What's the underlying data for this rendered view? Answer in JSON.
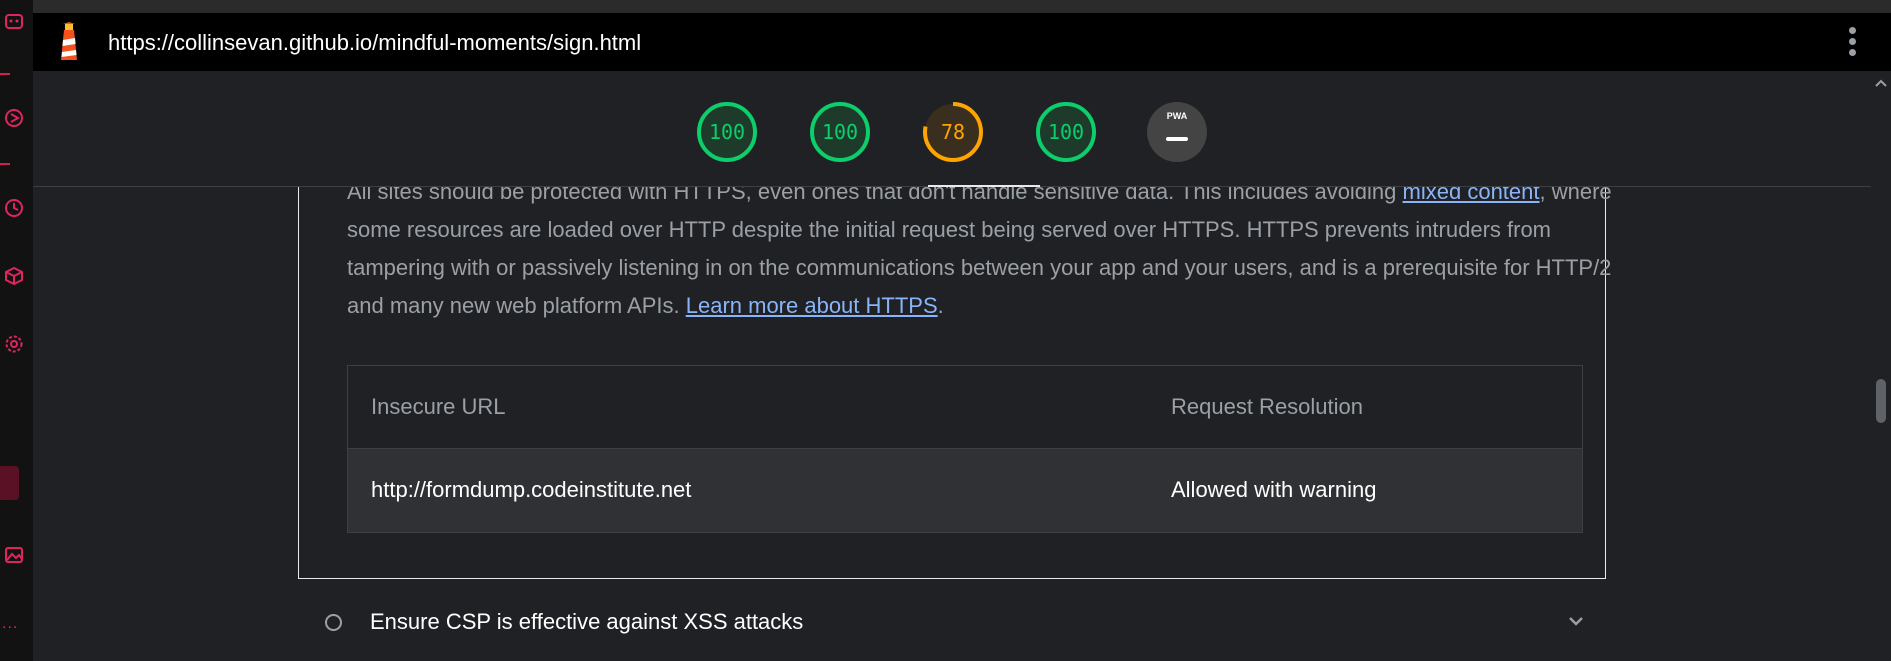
{
  "browser": {
    "url": "https://collinsevan.github.io/mindful-moments/sign.html"
  },
  "scores": [
    {
      "value": "100",
      "fraction": 1.0,
      "status": "pass",
      "color": "#0cce6b"
    },
    {
      "value": "100",
      "fraction": 1.0,
      "status": "pass",
      "color": "#0cce6b"
    },
    {
      "value": "78",
      "fraction": 0.78,
      "status": "average",
      "color": "#ffa400"
    },
    {
      "value": "100",
      "fraction": 1.0,
      "status": "pass",
      "color": "#0cce6b"
    },
    {
      "label": "PWA",
      "status": "na",
      "color": "#9aa0a6"
    }
  ],
  "audit_detail": {
    "text_1": "All sites should be protected with HTTPS, even ones that don't handle sensitive data. This includes avoiding ",
    "link_1": "mixed content",
    "text_2": ", where some resources are loaded over HTTP despite the initial request being served over HTTPS. HTTPS prevents intruders from tampering with or passively listening in on the communications between your app and your users, and is a prerequisite for HTTP/2 and many new web platform APIs. ",
    "link_2": "Learn more about HTTPS",
    "text_3": ".",
    "table": {
      "headers": [
        "Insecure URL",
        "Request Resolution"
      ],
      "rows": [
        [
          "http://formdump.codeinstitute.net",
          "Allowed with warning"
        ]
      ]
    }
  },
  "next_audit": {
    "title": "Ensure CSP is effective against XSS attacks"
  },
  "colors": {
    "accent": "#e0245e",
    "pass": "#0cce6b",
    "average": "#ffa400",
    "link": "#8ab4f8"
  }
}
